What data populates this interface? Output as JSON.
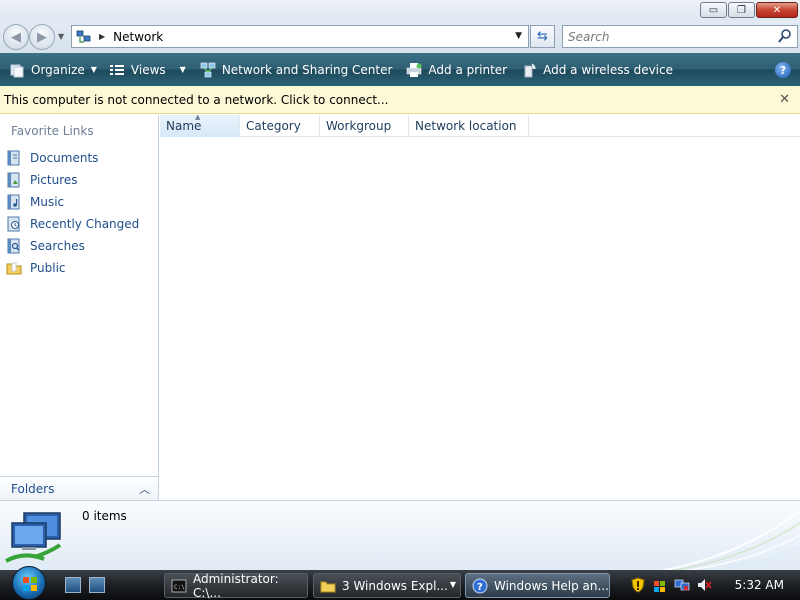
{
  "titlebar": {
    "minimize": "▭",
    "maximize": "❐",
    "close": "✕"
  },
  "address": {
    "location": "Network",
    "search_placeholder": "Search"
  },
  "toolbar": {
    "organize": "Organize",
    "views": "Views",
    "network_sharing": "Network and Sharing Center",
    "add_printer": "Add a printer",
    "add_wireless": "Add a wireless device",
    "help": "?"
  },
  "infobar": {
    "message": "This computer is not connected to a network. Click to connect...",
    "close": "✕"
  },
  "navpane": {
    "favorite_links_title": "Favorite Links",
    "links": [
      {
        "label": "Documents",
        "icon": "documents-icon"
      },
      {
        "label": "Pictures",
        "icon": "pictures-icon"
      },
      {
        "label": "Music",
        "icon": "music-icon"
      },
      {
        "label": "Recently Changed",
        "icon": "recently-changed-icon"
      },
      {
        "label": "Searches",
        "icon": "searches-icon"
      },
      {
        "label": "Public",
        "icon": "public-folder-icon"
      }
    ],
    "folders_label": "Folders"
  },
  "content": {
    "columns": [
      "Name",
      "Category",
      "Workgroup",
      "Network location"
    ],
    "sorted_column": "Name"
  },
  "details": {
    "item_count": "0 items"
  },
  "taskbar": {
    "tasks": [
      {
        "label": "Administrator: C:\\...",
        "icon": "command-prompt-icon"
      },
      {
        "label": "3 Windows Expl...",
        "icon": "folder-icon"
      },
      {
        "label": "Windows Help an...",
        "icon": "help-icon"
      }
    ],
    "clock": "5:32 AM"
  },
  "colors": {
    "command_bar": "#2f5f73",
    "info_bar": "#fdf8d6",
    "link_text": "#1f4e8c",
    "taskbar": "#1d2024"
  }
}
